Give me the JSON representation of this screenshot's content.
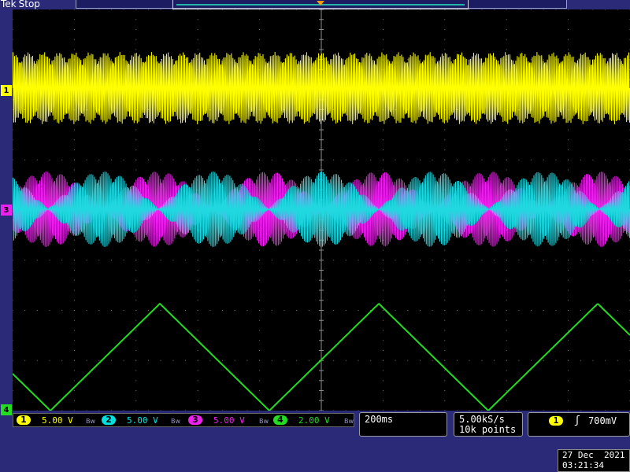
{
  "header": {
    "brand": "Tek",
    "run_state": "Stop"
  },
  "channels": [
    {
      "num": "1",
      "scale": "5.00 V",
      "color": "#ffff00"
    },
    {
      "num": "2",
      "scale": "5.00 V",
      "color": "#00e0e0"
    },
    {
      "num": "3",
      "scale": "5.00 V",
      "color": "#ee22ee"
    },
    {
      "num": "4",
      "scale": "2.00 V",
      "color": "#22dd22"
    }
  ],
  "bw_icon": "Bw",
  "timebase": {
    "scale": "200ms"
  },
  "acquisition": {
    "rate": "5.00kS/s",
    "points": "10k points"
  },
  "trigger": {
    "channel": "1",
    "slope_icon": "rising-edge-icon",
    "slope_glyph": "ʃ",
    "level": "700mV"
  },
  "datetime": {
    "date": "27 Dec  2021",
    "time": "03:21:34"
  },
  "markers": {
    "ch1": "1",
    "ch2": "2",
    "ch3": "3",
    "ch4": "4",
    "trigger_position_icon": "trigger-position-icon"
  },
  "colors": {
    "background": "#2a2a78",
    "graticule": "#000000",
    "grid": "#808080"
  }
}
